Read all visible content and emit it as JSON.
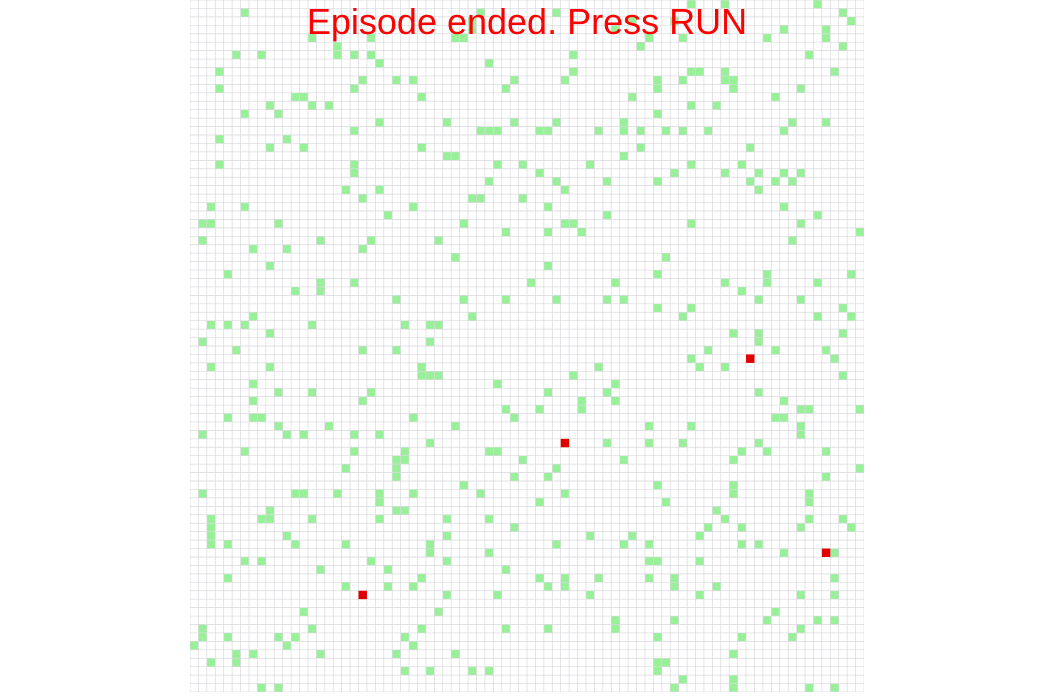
{
  "status_message": "Episode ended. Press RUN",
  "colors": {
    "grid_line": "#d9d9de",
    "background": "#ffffff",
    "food": "#98f098",
    "agent": "#e00000",
    "status_text": "#ff0000"
  },
  "grid": {
    "columns": 80,
    "rows": 82
  },
  "agents": [
    {
      "col": 66,
      "row": 42
    },
    {
      "col": 44,
      "row": 52
    },
    {
      "col": 75,
      "row": 65
    },
    {
      "col": 20,
      "row": 70
    }
  ],
  "food_density": 0.06
}
